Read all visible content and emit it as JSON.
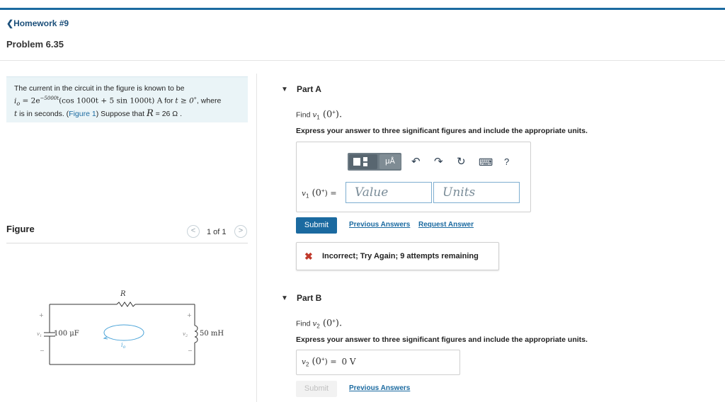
{
  "header": {
    "back_link": "Homework #9",
    "title": "Problem 6.35"
  },
  "problem": {
    "line1": "The current in the circuit in the figure is known to be",
    "eq": "i",
    "eq_sub": "o",
    "eq_mid": " = 2e",
    "eq_exp": "−5000t",
    "eq_rest": "(cos 1000t + 5 sin 1000t) A",
    "for": " for ",
    "cond": "t ≥ 0",
    "cond_sup": "+",
    "where": ", where",
    "line3a": "t",
    "line3b": " is in seconds. (",
    "figure_link": "Figure 1",
    "line3c": ") Suppose that ",
    "r_sym": "R",
    "r_val": " = 26  Ω ."
  },
  "figure": {
    "label": "Figure",
    "counter": "1 of 1",
    "prev": "<",
    "next": ">",
    "labels": {
      "resistor": "R",
      "cap_value": "100 μF",
      "ind_value": "50 mH",
      "v1": "v",
      "v1_sub": "1",
      "v2": "v",
      "v2_sub": "2",
      "io": "i",
      "io_sub": "o",
      "plus": "+",
      "minus": "−"
    }
  },
  "partA": {
    "arrow": "▼",
    "title": "Part A",
    "find_prefix": "Find ",
    "find_var": "v",
    "find_sub": "1",
    "find_arg": " (0",
    "find_sup": "+",
    "find_end": ").",
    "instruction": "Express your answer to three significant figures and include the appropriate units.",
    "toolbar": {
      "units_btn": "μÅ",
      "undo": "↶",
      "redo": "↷",
      "reset": "↻",
      "keyboard": "⌨",
      "help": "?"
    },
    "input_label_var": "v",
    "input_label_sub": "1",
    "input_label_arg": " (0",
    "input_label_sup": "+",
    "input_label_end": ") =",
    "value_placeholder": "Value",
    "units_placeholder": "Units",
    "submit": "Submit",
    "previous_answers": "Previous Answers",
    "request_answer": "Request Answer",
    "feedback_icon": "✖",
    "feedback": "Incorrect; Try Again; 9 attempts remaining"
  },
  "partB": {
    "arrow": "▼",
    "title": "Part B",
    "find_prefix": "Find ",
    "find_var": "v",
    "find_sub": "2",
    "find_arg": " (0",
    "find_sup": "+",
    "find_end": ").",
    "instruction": "Express your answer to three significant figures and include the appropriate units.",
    "answer_var": "v",
    "answer_sub": "2",
    "answer_arg": " (0",
    "answer_sup": "+",
    "answer_end": ") =",
    "answer_value": "0 V",
    "submit": "Submit",
    "previous_answers": "Previous Answers"
  }
}
